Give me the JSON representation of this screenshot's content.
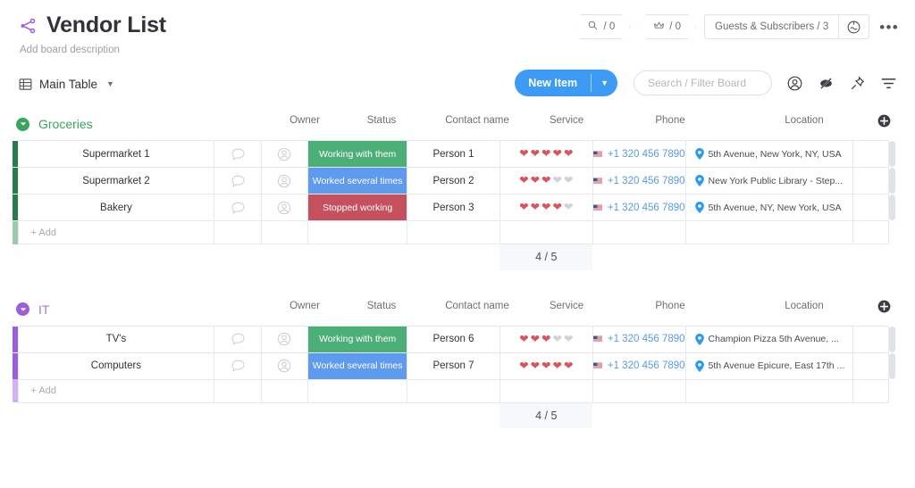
{
  "header": {
    "title": "Vendor List",
    "description": "Add board description",
    "share_icon": "share-nodes-icon",
    "hex_buttons": [
      {
        "icon": "activity-log-icon",
        "label": "/ 0"
      },
      {
        "icon": "crown-icon",
        "label": "/ 0"
      }
    ],
    "guests": {
      "label": "Guests & Subscribers / 3",
      "icon": "invite-members-icon"
    },
    "more_label": "•••"
  },
  "toolbar": {
    "view_tab": {
      "icon": "table-icon",
      "label": "Main Table",
      "chevron": "chevron-down-icon"
    },
    "new_item": {
      "label": "New Item",
      "chevron": "chevron-down-icon"
    },
    "search": {
      "placeholder": "Search / Filter Board",
      "value": ""
    },
    "icons": [
      {
        "name": "person-filter-icon"
      },
      {
        "name": "hide-eye-icon"
      },
      {
        "name": "pin-icon"
      },
      {
        "name": "sort-filter-icon"
      }
    ]
  },
  "columns": [
    "Owner",
    "Status",
    "Contact name",
    "Service",
    "Phone",
    "Location"
  ],
  "add_column_icon": "plus-circle-icon",
  "add_row_label": "+ Add",
  "colors": {
    "green_group": "#3aa35f",
    "purple_group": "#9d7bd8",
    "row_bar_green": "#2c7a45",
    "row_bar_green_light": "#9dc9ac",
    "row_bar_purple": "#9d5fd8",
    "row_bar_purple_light": "#d2b3ee",
    "status_working": "#4caf77",
    "status_worked": "#5f9aef",
    "status_stopped": "#c5515f",
    "phone_link": "#5a9ae0",
    "heart_on": "#d8545f",
    "heart_off": "#cfd2d7",
    "primary_button": "#3d9bf5"
  },
  "groups": [
    {
      "title": "Groceries",
      "color_class": "green",
      "bar_color": "#2c7a45",
      "bar_color_light": "#9dc9ac",
      "summary": "4 / 5",
      "rows": [
        {
          "name": "Supermarket 1",
          "status": {
            "label": "Working with them",
            "color": "#4caf77"
          },
          "contact": "Person 1",
          "service_filled": 5,
          "service_total": 5,
          "phone": "+1 320 456 7890",
          "location": "5th Avenue, New York, NY, USA"
        },
        {
          "name": "Supermarket 2",
          "status": {
            "label": "Worked several times",
            "color": "#5f9aef"
          },
          "contact": "Person 2",
          "service_filled": 3,
          "service_total": 5,
          "phone": "+1 320 456 7890",
          "location": "New York Public Library - Step..."
        },
        {
          "name": "Bakery",
          "status": {
            "label": "Stopped working",
            "color": "#c5515f"
          },
          "contact": "Person 3",
          "service_filled": 4,
          "service_total": 5,
          "phone": "+1 320 456 7890",
          "location": "5th Avenue, NY, New York, USA"
        }
      ]
    },
    {
      "title": "IT",
      "color_class": "purple",
      "bar_color": "#9d5fd8",
      "bar_color_light": "#d2b3ee",
      "summary": "4 / 5",
      "rows": [
        {
          "name": "TV's",
          "status": {
            "label": "Working with them",
            "color": "#4caf77"
          },
          "contact": "Person 6",
          "service_filled": 3,
          "service_total": 5,
          "phone": "+1 320 456 7890",
          "location": "Champion Pizza 5th Avenue, ..."
        },
        {
          "name": "Computers",
          "status": {
            "label": "Worked several times",
            "color": "#5f9aef"
          },
          "contact": "Person 7",
          "service_filled": 5,
          "service_total": 5,
          "phone": "+1 320 456 7890",
          "location": "5th Avenue Epicure, East 17th ..."
        }
      ]
    }
  ]
}
